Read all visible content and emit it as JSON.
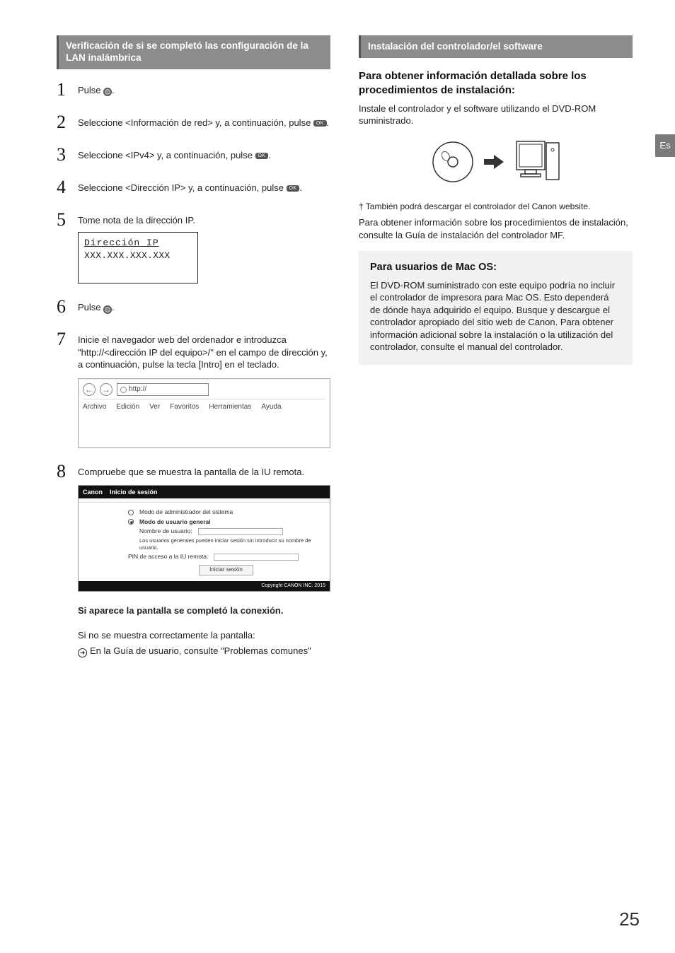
{
  "sideTab": "Es",
  "pageNumber": "25",
  "left": {
    "header": "Verificación de si se completó las configuración de la LAN inalámbrica",
    "steps": {
      "1": {
        "text_pre": "Pulse ",
        "text_post": "."
      },
      "2": {
        "text_pre": "Seleccione <Información de red> y, a continuación, pulse ",
        "text_post": "."
      },
      "3": {
        "text_pre": "Seleccione <IPv4> y, a continuación, pulse ",
        "text_post": "."
      },
      "4": {
        "text_pre": "Seleccione <Dirección IP> y, a continuación, pulse ",
        "text_post": "."
      },
      "5": {
        "text": "Tome nota de la dirección IP.",
        "ip_title": "Dirección IP",
        "ip_value": "XXX.XXX.XXX.XXX"
      },
      "6": {
        "text_pre": "Pulse ",
        "text_post": "."
      },
      "7": {
        "text": "Inicie el navegador web del ordenador e introduzca \"http://<dirección IP del equipo>/\" en el campo de dirección y, a continuación, pulse la tecla [Intro] en el teclado.",
        "url": "http://",
        "menu": [
          "Archivo",
          "Edición",
          "Ver",
          "Favoritos",
          "Herramientas",
          "Ayuda"
        ]
      },
      "8": {
        "text": "Compruebe que se muestra la pantalla de la IU remota.",
        "login_brand": "Canon",
        "login_title": "Inicio de sesión",
        "mode_admin": "Modo de administrador del sistema",
        "mode_user": "Modo de usuario general",
        "user_label": "Nombre de usuario:",
        "user_hint": "Los usuarios generales pueden iniciar sesión sin introducir su nombre de usuario.",
        "pin_label": "PIN de acceso a la IU remota:",
        "login_btn": "Iniciar sesión",
        "copyright": "Copyright CANON INC. 2015"
      }
    },
    "completed": "Si aparece la pantalla se completó la conexión.",
    "notShown": "Si no se muestra correctamente la pantalla:",
    "guideRef": "En la Guía de usuario, consulte \"Problemas comunes\""
  },
  "right": {
    "header": "Instalación del controlador/el software",
    "subhead1": "Para obtener información detallada sobre los procedimientos de instalación:",
    "body1": "Instale el controlador y el software utilizando el DVD-ROM suministrado.",
    "dagger": "† También podrá descargar el controlador del Canon website.",
    "body2": "Para obtener información sobre los procedimientos de instalación, consulte la Guía de instalación del controlador MF.",
    "mac_title": "Para usuarios de Mac OS:",
    "mac_body": "El DVD-ROM suministrado con este equipo podría no incluir el controlador de impresora para Mac OS. Esto dependerá de dónde haya adquirido el equipo. Busque y descargue el controlador apropiado del sitio web de Canon. Para obtener información adicional sobre la instalación o la utilización del controlador, consulte el manual del controlador."
  }
}
